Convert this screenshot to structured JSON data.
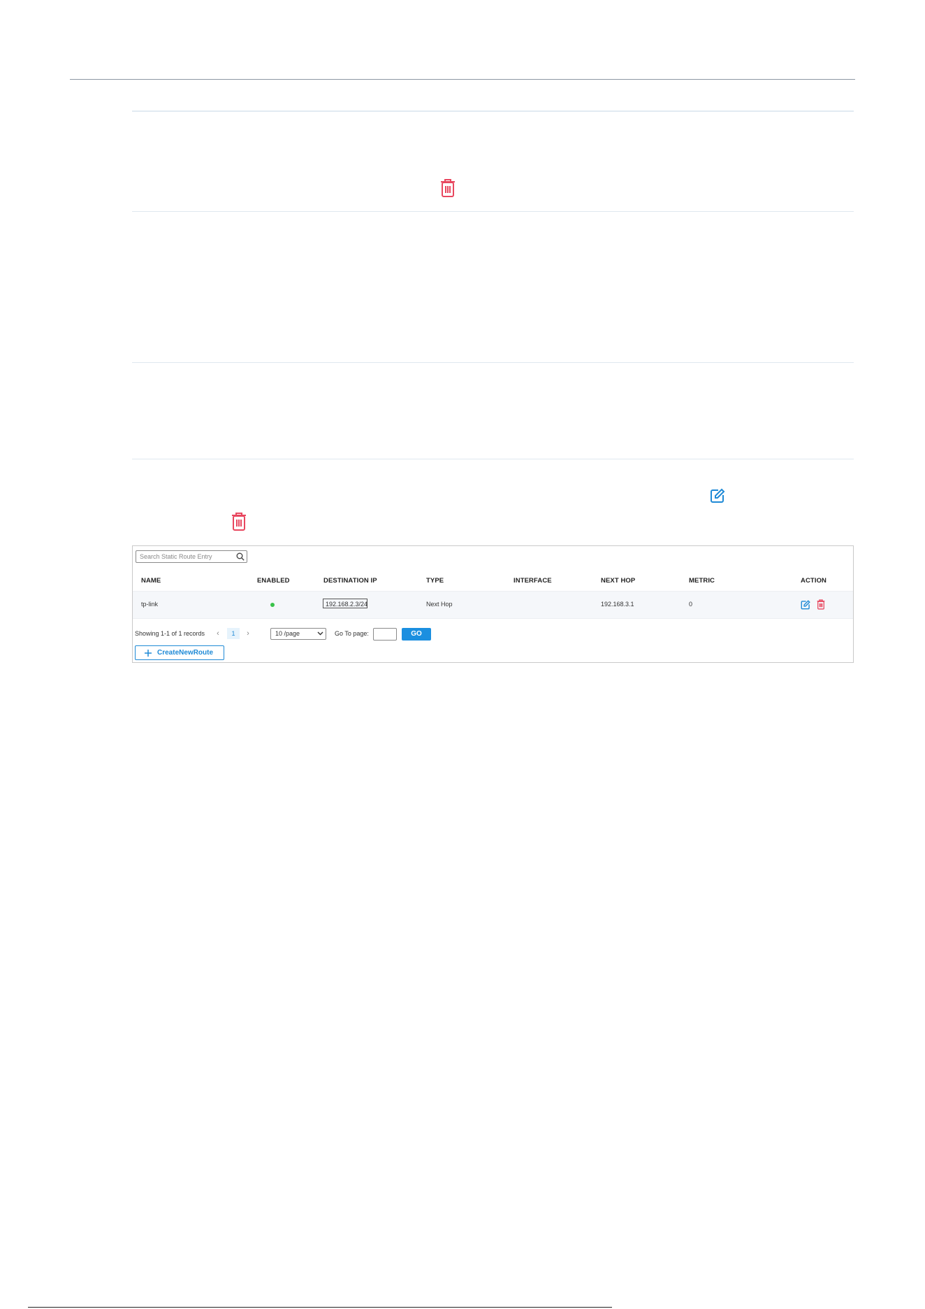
{
  "colors": {
    "accent": "#1f8ad6",
    "delete": "#e8475f",
    "enabled": "#3ac24a",
    "rule": "#dde6ee"
  },
  "icons": {
    "delete": "trash-icon",
    "edit": "edit-icon",
    "search": "search-icon",
    "plus": "plus-icon"
  },
  "route_table": {
    "search": {
      "placeholder": "Search Static Route Entry"
    },
    "columns": [
      "NAME",
      "ENABLED",
      "DESTINATION IP",
      "TYPE",
      "INTERFACE",
      "NEXT HOP",
      "METRIC",
      "ACTION"
    ],
    "rows": [
      {
        "name": "tp-link",
        "enabled": true,
        "destination_ip": "192.168.2.3/24",
        "type": "Next Hop",
        "interface": "",
        "next_hop": "192.168.3.1",
        "metric": "0"
      }
    ],
    "pagination": {
      "showing": "Showing 1-1 of 1 records",
      "prev": "‹",
      "current_page": "1",
      "next": "›",
      "page_size": "10 /page",
      "goto_label": "Go To page:",
      "goto_value": "",
      "go_label": "GO"
    },
    "create_label": "CreateNewRoute"
  }
}
